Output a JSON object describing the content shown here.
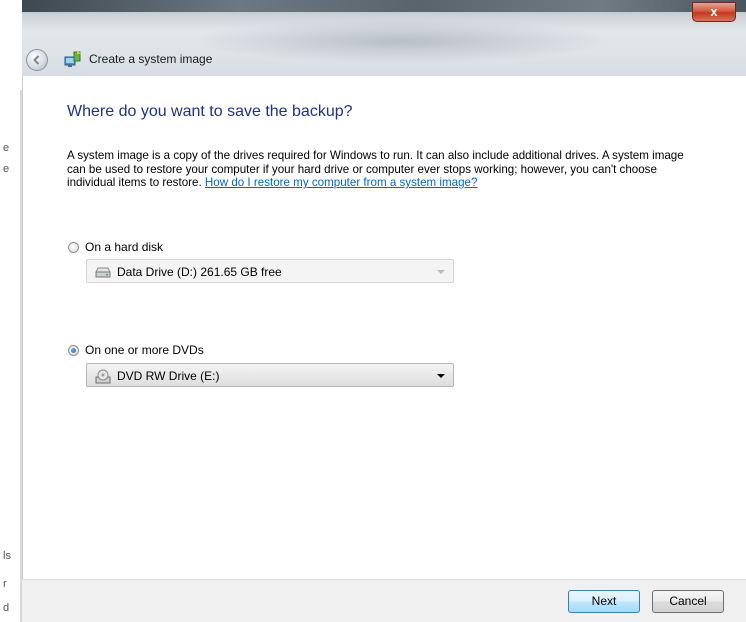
{
  "window": {
    "title": "Create a system image",
    "close_label": "x"
  },
  "background_fragments": [
    "e",
    "e",
    "ls",
    "r",
    "d"
  ],
  "content": {
    "heading": "Where do you want to save the backup?",
    "description": "A system image is a copy of the drives required for Windows to run. It can also include additional drives. A system image can be used to restore your computer if your hard drive or computer ever stops working; however, you can't choose individual items to restore.",
    "help_link": "How do I restore my computer from a system image?"
  },
  "options": {
    "hard_disk": {
      "label": "On a hard disk",
      "selected": false,
      "drive_value": "Data Drive (D:)  261.65 GB free",
      "enabled": false
    },
    "dvd": {
      "label": "On one or more DVDs",
      "selected": true,
      "drive_value": "DVD RW Drive (E:)",
      "enabled": true
    }
  },
  "footer": {
    "next_label": "Next",
    "cancel_label": "Cancel"
  }
}
